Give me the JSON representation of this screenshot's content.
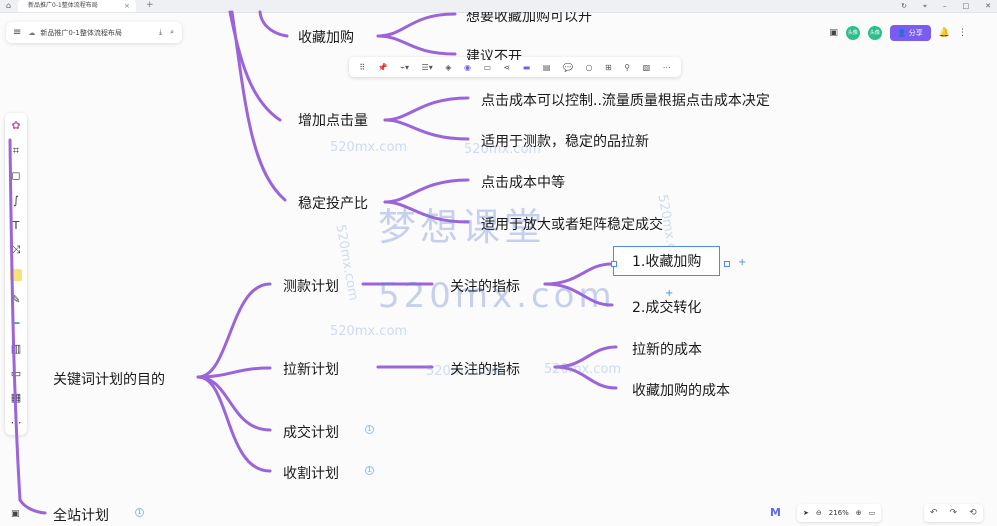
{
  "window": {
    "tab_title": "新品推广0-1整体流程布局",
    "tab_close": "×",
    "tab_add": "+"
  },
  "docbar": {
    "menu_icon": "≡",
    "title": "新品推广0-1整体流程布局"
  },
  "toolbar": {
    "share_label": "分享",
    "avatar1": "头像",
    "avatar2": "头像"
  },
  "mindmap": {
    "root": "关键词计划的目的",
    "allsite": "全站计划",
    "cat1": "收藏加购",
    "cat1_c1": "想要收藏加购可以开",
    "cat1_c2": "建议不开",
    "cat2": "增加点击量",
    "cat2_c1": "点击成本可以控制..流量质量根据点击成本决定",
    "cat2_c2": "适用于测款，稳定的品拉新",
    "cat3": "稳定投产比",
    "cat3_c1": "点击成本中等",
    "cat3_c2": "适用于放大或者矩阵稳定成交",
    "plan1": "测款计划",
    "plan1_sub": "关注的指标",
    "plan1_m1": "1.收藏加购",
    "plan1_m2": "2.成交转化",
    "plan2": "拉新计划",
    "plan2_sub": "关注的指标",
    "plan2_m1": "拉新的成本",
    "plan2_m2": "收藏加购的成本",
    "plan3": "成交计划",
    "plan4": "收割计划",
    "badge_num": "1"
  },
  "watermark": {
    "big_cn": "梦想课堂",
    "big_en": "520mx.com",
    "small": "520mx.com"
  },
  "zoom": {
    "level": "216%"
  },
  "colors": {
    "branch": "#9b64d8",
    "accent": "#7b5cf0",
    "selection": "#4a8af4"
  }
}
